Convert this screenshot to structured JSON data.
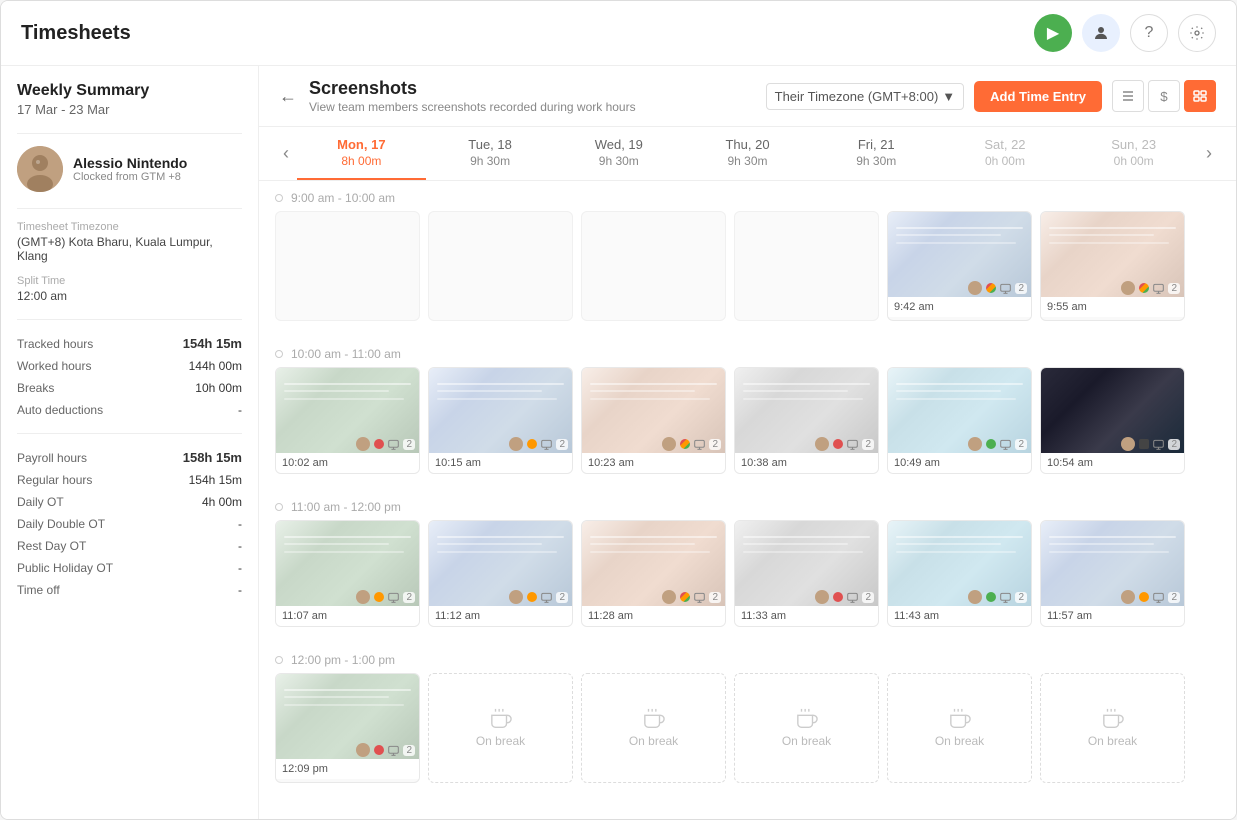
{
  "app": {
    "title": "Timesheets"
  },
  "sidebar": {
    "weekly_summary_title": "Weekly Summary",
    "weekly_summary_date": "17 Mar - 23 Mar",
    "user": {
      "name": "Alessio Nintendo",
      "clocked_from": "Clocked from GTM +8"
    },
    "timezone": {
      "label": "Timesheet Timezone",
      "value": "(GMT+8) Kota Bharu, Kuala Lumpur, Klang"
    },
    "split_time": {
      "label": "Split Time",
      "value": "12:00 am"
    },
    "tracked": {
      "label": "Tracked hours",
      "value": "154h 15m"
    },
    "worked": {
      "label": "Worked hours",
      "value": "144h 00m"
    },
    "breaks": {
      "label": "Breaks",
      "value": "10h 00m"
    },
    "auto_deductions": {
      "label": "Auto deductions",
      "value": "-"
    },
    "payroll": {
      "label": "Payroll hours",
      "value": "158h 15m"
    },
    "regular_hours": {
      "label": "Regular hours",
      "value": "154h 15m"
    },
    "daily_ot": {
      "label": "Daily OT",
      "value": "4h 00m"
    },
    "daily_double_ot": {
      "label": "Daily Double OT",
      "value": "-"
    },
    "rest_day_ot": {
      "label": "Rest Day OT",
      "value": "-"
    },
    "public_holiday_ot": {
      "label": "Public Holiday OT",
      "value": "-"
    },
    "time_off": {
      "label": "Time off",
      "value": "-"
    }
  },
  "content": {
    "section_title": "Screenshots",
    "section_subtitle": "View team members screenshots recorded during work hours",
    "timezone_selector": "Their Timezone (GMT+8:00)",
    "add_time_entry": "Add Time Entry",
    "back_arrow": "←"
  },
  "days": [
    {
      "name": "Mon, 17",
      "hours": "8h 00m",
      "active": true
    },
    {
      "name": "Tue, 18",
      "hours": "9h 30m",
      "active": false
    },
    {
      "name": "Wed, 19",
      "hours": "9h 30m",
      "active": false
    },
    {
      "name": "Thu, 20",
      "hours": "9h 30m",
      "active": false
    },
    {
      "name": "Fri, 21",
      "hours": "9h 30m",
      "active": false
    },
    {
      "name": "Sat, 22",
      "hours": "0h 00m",
      "active": false
    },
    {
      "name": "Sun, 23",
      "hours": "0h 00m",
      "active": false
    }
  ],
  "time_blocks": [
    {
      "label": "9:00 am - 10:00 am",
      "screenshots": [
        {
          "time": "9:42 am",
          "count": "2",
          "style": "ss-2"
        },
        {
          "time": "9:55 am",
          "count": "2",
          "style": "ss-3"
        }
      ],
      "empty_slots": 4
    },
    {
      "label": "10:00 am - 11:00 am",
      "screenshots": [
        {
          "time": "10:02 am",
          "count": "2",
          "style": "ss-1"
        },
        {
          "time": "10:15 am",
          "count": "2",
          "style": "ss-2"
        },
        {
          "time": "10:23 am",
          "count": "2",
          "style": "ss-3"
        },
        {
          "time": "10:38 am",
          "count": "2",
          "style": "ss-4"
        },
        {
          "time": "10:49 am",
          "count": "2",
          "style": "ss-5"
        },
        {
          "time": "10:54 am",
          "count": "2",
          "style": "ss-dark"
        }
      ],
      "empty_slots": 0
    },
    {
      "label": "11:00 am - 12:00 pm",
      "screenshots": [
        {
          "time": "11:07 am",
          "count": "2",
          "style": "ss-1"
        },
        {
          "time": "11:12 am",
          "count": "2",
          "style": "ss-2"
        },
        {
          "time": "11:28 am",
          "count": "2",
          "style": "ss-3"
        },
        {
          "time": "11:33 am",
          "count": "2",
          "style": "ss-4"
        },
        {
          "time": "11:43 am",
          "count": "2",
          "style": "ss-5"
        },
        {
          "time": "11:57 am",
          "count": "2",
          "style": "ss-2"
        }
      ],
      "empty_slots": 0
    },
    {
      "label": "12:00 pm - 1:00 pm",
      "screenshots": [
        {
          "time": "12:09 pm",
          "count": "2",
          "style": "ss-1"
        }
      ],
      "on_break_count": 5,
      "empty_slots": 0
    }
  ]
}
